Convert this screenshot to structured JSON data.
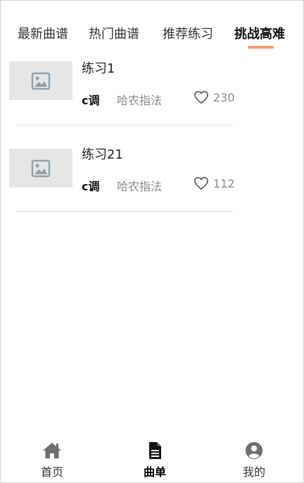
{
  "tabs": [
    {
      "label": "最新曲谱"
    },
    {
      "label": "热门曲谱"
    },
    {
      "label": "推荐练习"
    },
    {
      "label": "挑战高难"
    }
  ],
  "active_tab_index": 3,
  "accent_color": "#f39a72",
  "items": [
    {
      "title": "练习1",
      "key": "c调",
      "fingering": "哈农指法",
      "likes": "230",
      "thumbnail_icon": "image-placeholder-icon",
      "like_icon": "heart-outline-icon"
    },
    {
      "title": "练习21",
      "key": "c调",
      "fingering": "哈农指法",
      "likes": "112",
      "thumbnail_icon": "image-placeholder-icon",
      "like_icon": "heart-outline-icon"
    }
  ],
  "bottom_nav": [
    {
      "label": "首页",
      "icon": "home-icon"
    },
    {
      "label": "曲单",
      "icon": "document-icon"
    },
    {
      "label": "我的",
      "icon": "user-circle-icon"
    }
  ],
  "active_nav_index": 1
}
